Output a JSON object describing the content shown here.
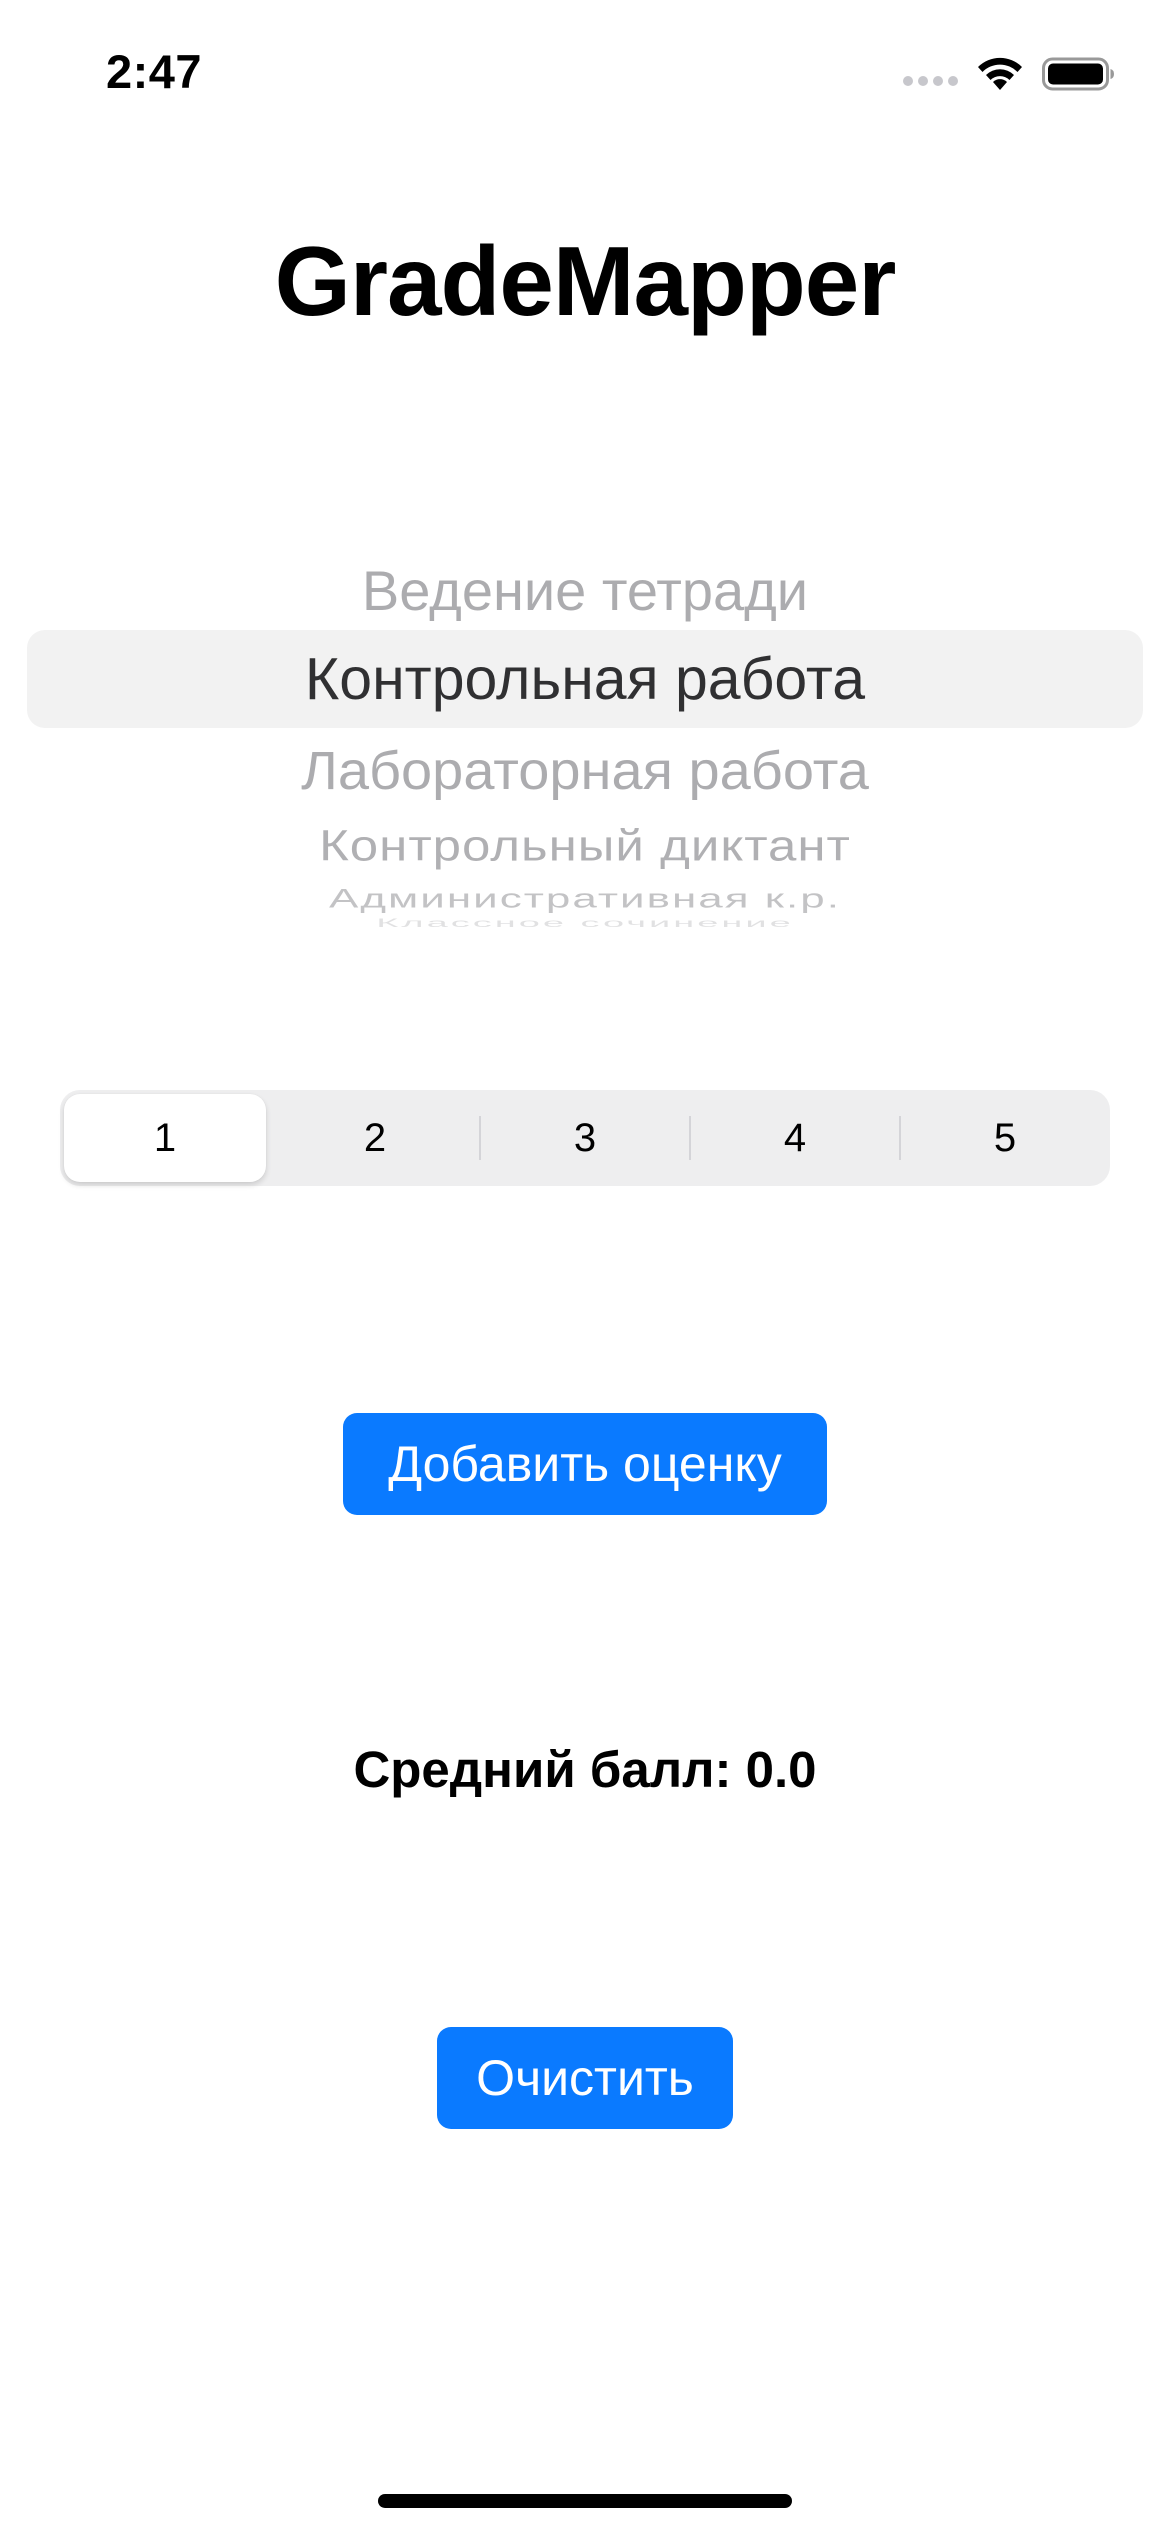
{
  "status_bar": {
    "time": "2:47",
    "icons": [
      "signal-dots-icon",
      "wifi-icon",
      "battery-icon"
    ]
  },
  "title": "GradeMapper",
  "picker": {
    "items": [
      "Ведение тетради",
      "Контрольная работа",
      "Лабораторная работа",
      "Контрольный диктант",
      "Административная к.р.",
      "Классное сочинение"
    ],
    "selected": "Контрольная работа"
  },
  "grade_segments": {
    "options": [
      "1",
      "2",
      "3",
      "4",
      "5"
    ],
    "selected": "1"
  },
  "add_button_label": "Добавить оценку",
  "average_text": "Средний балл: 0.0",
  "clear_button_label": "Очистить",
  "colors": {
    "accent": "#0a7aff",
    "background": "#ffffff",
    "segmented_bg": "#eeeeef",
    "picker_highlight": "#f2f2f2"
  }
}
